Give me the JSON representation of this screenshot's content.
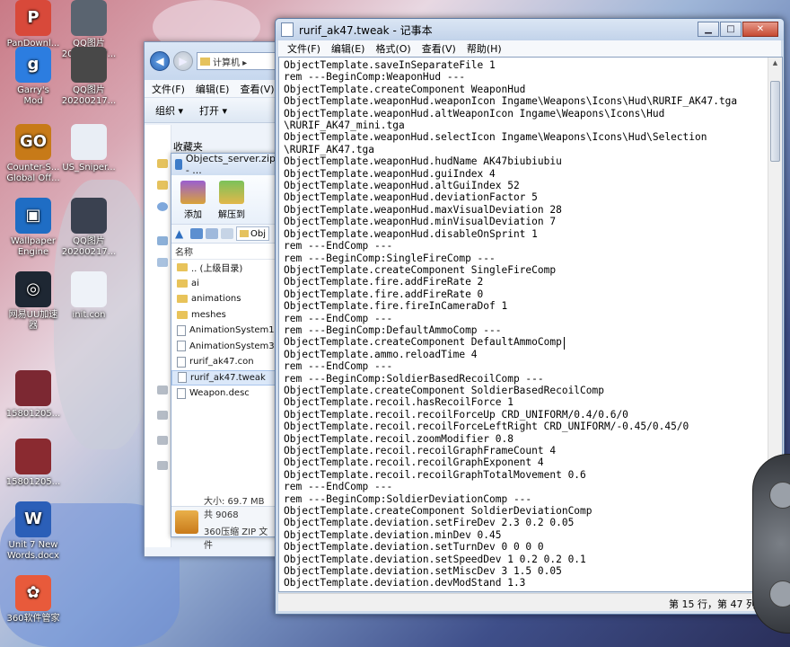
{
  "desktop": {
    "icons": [
      {
        "label": "PanDownl...",
        "color": "#d8493a",
        "glyph": "P"
      },
      {
        "label": "QQ图片\n20200217...",
        "color": "#5a6470",
        "glyph": ""
      },
      {
        "label": "Garry's\nMod",
        "color": "#2c7de0",
        "glyph": "g"
      },
      {
        "label": "QQ图片\n20200217...",
        "color": "#484848",
        "glyph": ""
      },
      {
        "label": "Counter-S...\nGlobal Off...",
        "color": "#c77a18",
        "glyph": "GO"
      },
      {
        "label": "US_Sniper...",
        "color": "#e9eef5",
        "glyph": ""
      },
      {
        "label": "Wallpaper\nEngine",
        "color": "#1f6dc4",
        "glyph": "▣"
      },
      {
        "label": "QQ图片\n20200217...",
        "color": "#3a4150",
        "glyph": ""
      },
      {
        "label": "网易UU加速\n器",
        "color": "#1e2733",
        "glyph": "◎"
      },
      {
        "label": "init.con",
        "color": "#eef2f8",
        "glyph": ""
      },
      {
        "label": "15801205...",
        "color": "#7c2832",
        "glyph": ""
      },
      {
        "label": "15801205...",
        "color": "#8a2a30",
        "glyph": ""
      },
      {
        "label": "Unit 7 New\nWords.docx",
        "color": "#2b5fb8",
        "glyph": "W"
      },
      {
        "label": "360软件管家",
        "color": "#e85a3b",
        "glyph": "✿"
      }
    ]
  },
  "explorer": {
    "address": "计算机 ▸",
    "menu": [
      "文件(F)",
      "编辑(E)",
      "查看(V)"
    ],
    "toolbar": [
      "组织 ▾",
      "打开 ▾"
    ],
    "favorites": "收藏夹"
  },
  "zip": {
    "title": "Objects_server.zip - ...",
    "tools": [
      "添加",
      "解压到"
    ],
    "path_box": "Obj",
    "column": "名称",
    "rows": [
      {
        "name": ".. (上级目录)",
        "type": "folder",
        "selected": false
      },
      {
        "name": "ai",
        "type": "folder",
        "selected": false
      },
      {
        "name": "animations",
        "type": "folder",
        "selected": false
      },
      {
        "name": "meshes",
        "type": "folder",
        "selected": false
      },
      {
        "name": "AnimationSystem1p.i",
        "type": "file",
        "selected": false
      },
      {
        "name": "AnimationSystem3p.i",
        "type": "file",
        "selected": false
      },
      {
        "name": "rurif_ak47.con",
        "type": "file",
        "selected": false
      },
      {
        "name": "rurif_ak47.tweak",
        "type": "file",
        "selected": true
      },
      {
        "name": "Weapon.desc",
        "type": "file",
        "selected": false
      }
    ],
    "status_size": "大小: 69.7 MB 共 9068",
    "status_type": "360压缩 ZIP 文件"
  },
  "notepad": {
    "title": "rurif_ak47.tweak - 记事本",
    "menu": [
      "文件(F)",
      "编辑(E)",
      "格式(O)",
      "查看(V)",
      "帮助(H)"
    ],
    "status": "第 15 行，第 47 列",
    "lines": [
      "ObjectTemplate.saveInSeparateFile 1",
      "rem ---BeginComp:WeaponHud ---",
      "ObjectTemplate.createComponent WeaponHud",
      "ObjectTemplate.weaponHud.weaponIcon Ingame\\Weapons\\Icons\\Hud\\RURIF_AK47.tga",
      "ObjectTemplate.weaponHud.altWeaponIcon Ingame\\Weapons\\Icons\\Hud",
      "\\RURIF_AK47_mini.tga",
      "ObjectTemplate.weaponHud.selectIcon Ingame\\Weapons\\Icons\\Hud\\Selection",
      "\\RURIF_AK47.tga",
      "ObjectTemplate.weaponHud.hudName AK47biubiubiu",
      "ObjectTemplate.weaponHud.guiIndex 4",
      "ObjectTemplate.weaponHud.altGuiIndex 52",
      "ObjectTemplate.weaponHud.deviationFactor 5",
      "ObjectTemplate.weaponHud.maxVisualDeviation 28",
      "ObjectTemplate.weaponHud.minVisualDeviation 7",
      "ObjectTemplate.weaponHud.disableOnSprint 1",
      "rem ---EndComp ---",
      "rem ---BeginComp:SingleFireComp ---",
      "ObjectTemplate.createComponent SingleFireComp",
      "ObjectTemplate.fire.addFireRate 2",
      "ObjectTemplate.fire.addFireRate 0",
      "ObjectTemplate.fire.fireInCameraDof 1",
      "rem ---EndComp ---",
      "rem ---BeginComp:DefaultAmmoComp ---",
      "ObjectTemplate.createComponent DefaultAmmoComp",
      "ObjectTemplate.ammo.reloadTime 4",
      "rem ---EndComp ---",
      "rem ---BeginComp:SoldierBasedRecoilComp ---",
      "ObjectTemplate.createComponent SoldierBasedRecoilComp",
      "ObjectTemplate.recoil.hasRecoilForce 1",
      "ObjectTemplate.recoil.recoilForceUp CRD_UNIFORM/0.4/0.6/0",
      "ObjectTemplate.recoil.recoilForceLeftRight CRD_UNIFORM/-0.45/0.45/0",
      "ObjectTemplate.recoil.zoomModifier 0.8",
      "ObjectTemplate.recoil.recoilGraphFrameCount 4",
      "ObjectTemplate.recoil.recoilGraphExponent 4",
      "ObjectTemplate.recoil.recoilGraphTotalMovement 0.6",
      "rem ---EndComp ---",
      "rem ---BeginComp:SoldierDeviationComp ---",
      "ObjectTemplate.createComponent SoldierDeviationComp",
      "ObjectTemplate.deviation.setFireDev 2.3 0.2 0.05",
      "ObjectTemplate.deviation.minDev 0.45",
      "ObjectTemplate.deviation.setTurnDev 0 0 0 0",
      "ObjectTemplate.deviation.setSpeedDev 1 0.2 0.2 0.1",
      "ObjectTemplate.deviation.setMiscDev 3 1.5 0.05",
      "ObjectTemplate.deviation.devModStand 1.3"
    ]
  }
}
